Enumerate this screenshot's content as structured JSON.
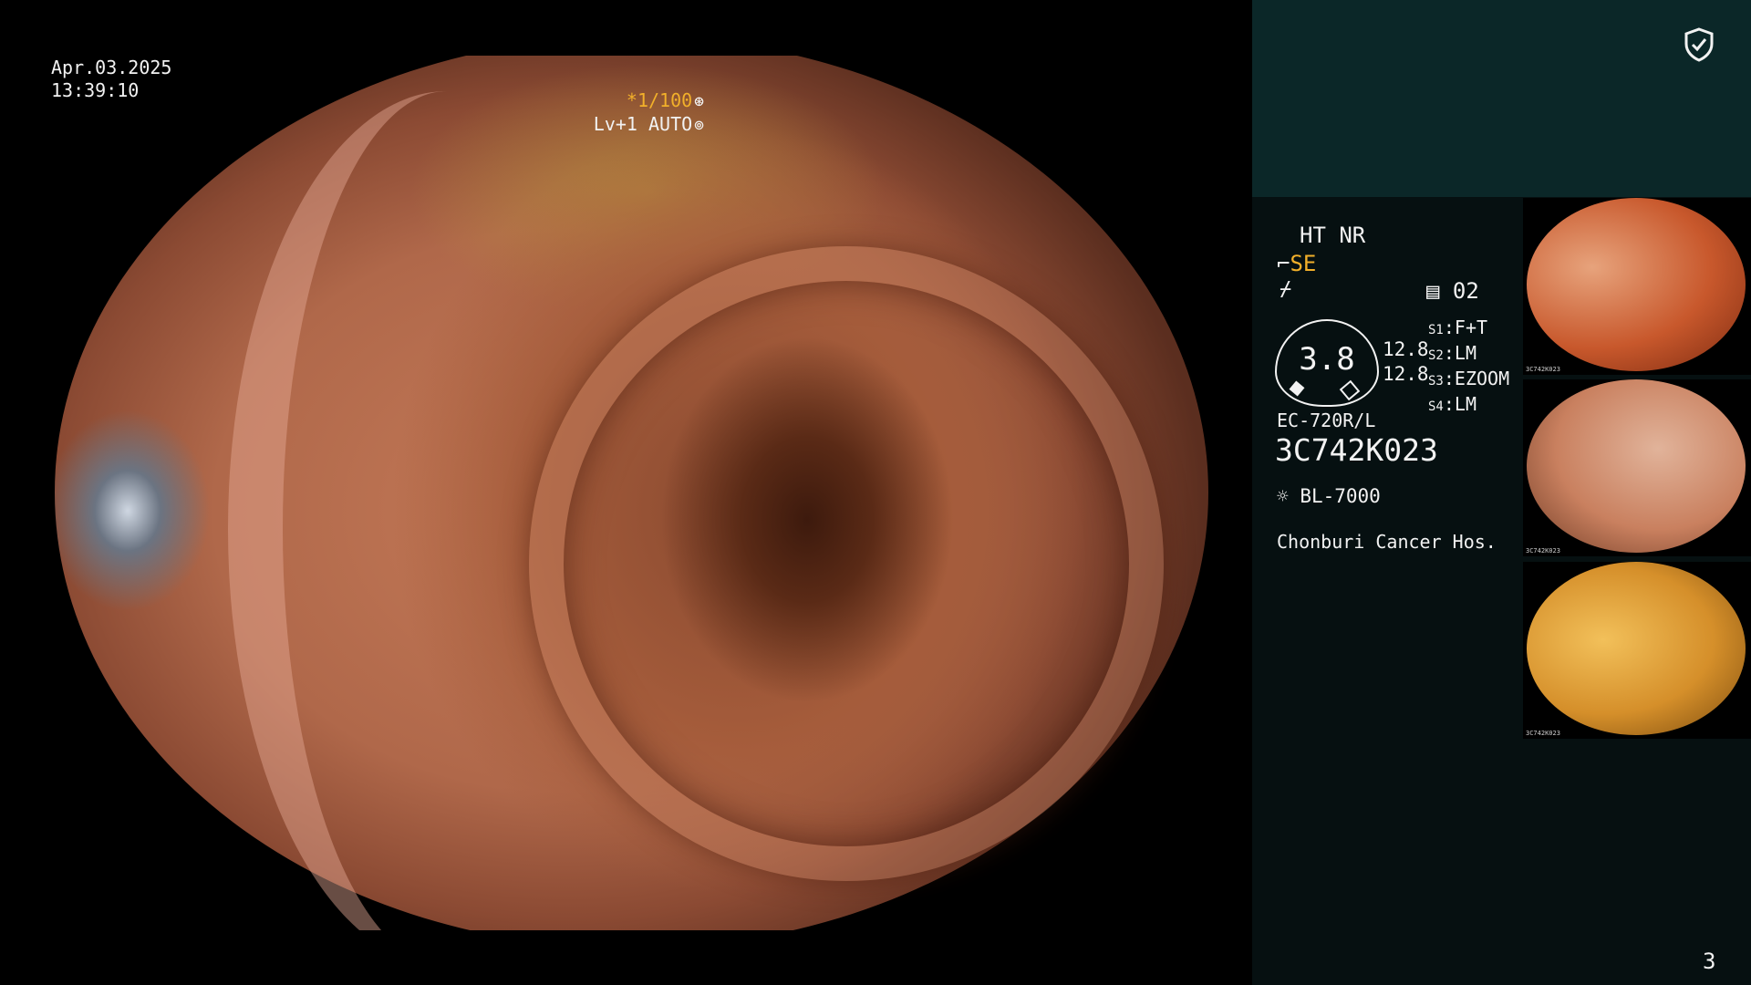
{
  "overlay": {
    "date": "Apr.03.2025",
    "time": "13:39:10",
    "shutter": "*1/100",
    "shutter_icon": "aperture-icon",
    "level": "Lv+1 AUTO",
    "level_icon": "iris-icon"
  },
  "panel": {
    "enhance": "HT NR",
    "se_label": "SE",
    "mode_value": "02",
    "gauge_value": "3.8",
    "gauge_right_values": [
      "12.8",
      "12.8"
    ],
    "settings": [
      {
        "key": "S1",
        "value": "F+T"
      },
      {
        "key": "S2",
        "value": "LM"
      },
      {
        "key": "S3",
        "value": "EZOOM"
      },
      {
        "key": "S4",
        "value": "LM"
      }
    ],
    "scope_model": "EC-720R/L",
    "serial": "3C742K023",
    "light_source": "BL-7000",
    "hospital": "Chonburi Cancer Hos.",
    "page_number": "3"
  },
  "thumbnails": [
    {
      "caption": "3C742K023"
    },
    {
      "caption": "3C742K023"
    },
    {
      "caption": "3C742K023"
    }
  ],
  "colors": {
    "amber": "#f2b02a",
    "panel_top": "#0b2728",
    "panel_body": "#061011"
  }
}
